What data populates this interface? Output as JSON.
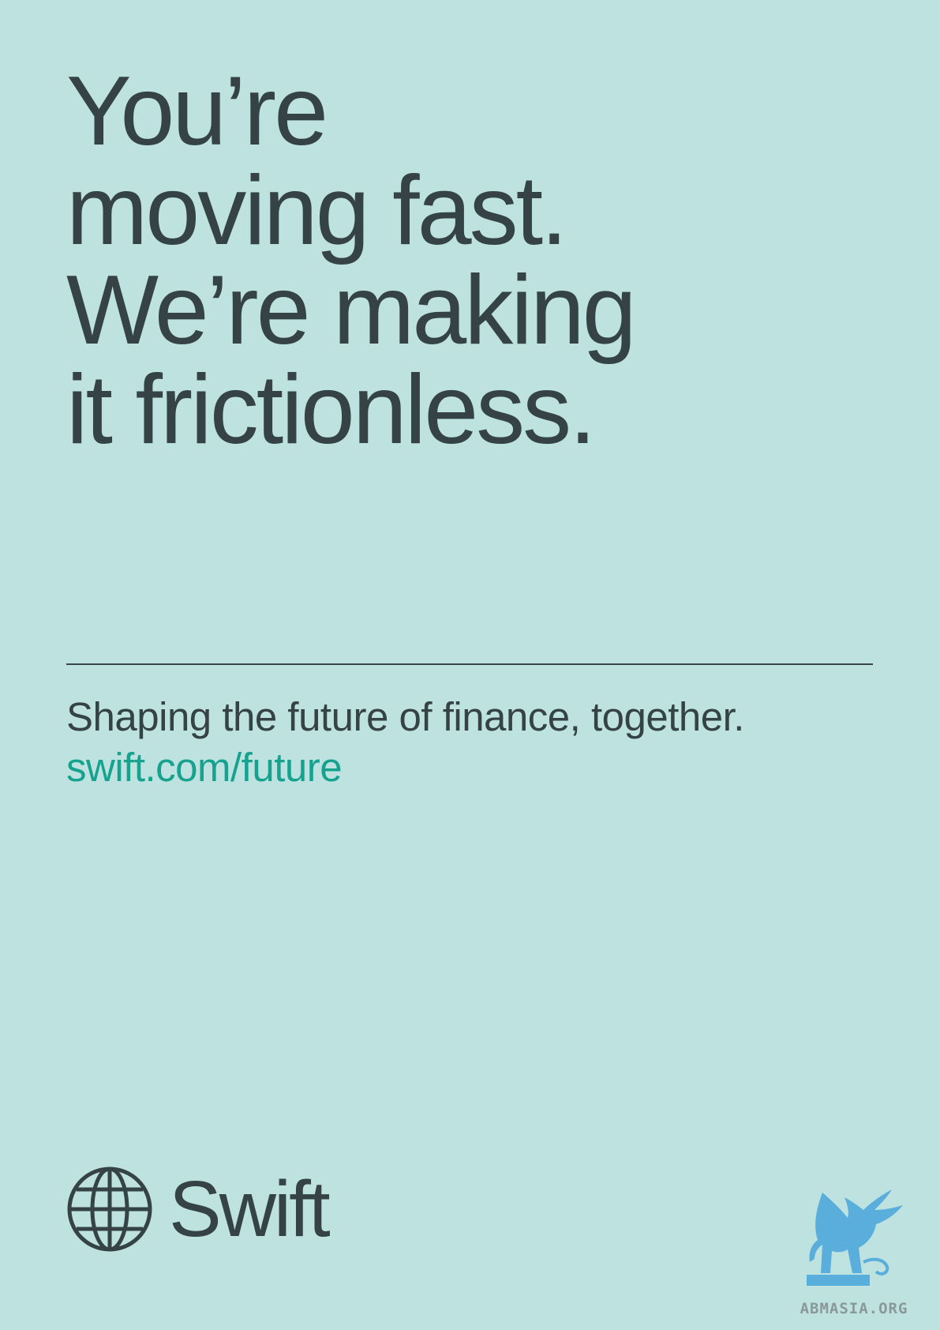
{
  "headline": {
    "lines": [
      "You’re",
      "moving fast.",
      "We’re making",
      "it frictionless."
    ]
  },
  "tagline": "Shaping the future of finance, together.",
  "url": "swift.com/future",
  "brand": {
    "name": "Swift",
    "logo_icon": "globe-icon"
  },
  "watermark": {
    "text": "ABMASIA.ORG",
    "icon": "griffin-icon"
  },
  "colors": {
    "background": "#bde2e0",
    "text": "#354347",
    "accent": "#17a290",
    "watermark": "#5aaedc"
  }
}
